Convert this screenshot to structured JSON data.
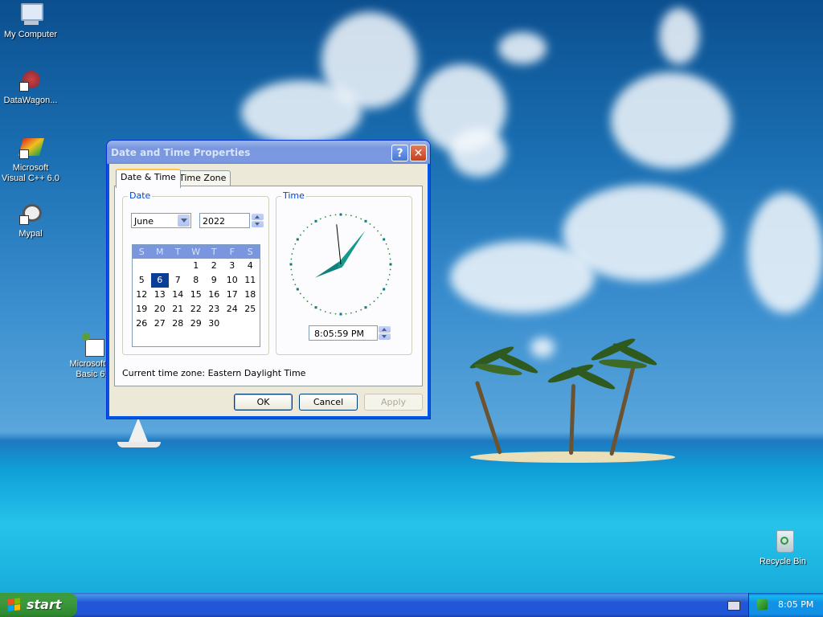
{
  "desktop": {
    "icons": [
      {
        "label": "My Computer"
      },
      {
        "label": "DataWagon..."
      },
      {
        "label": "Microsoft Visual C++ 6.0"
      },
      {
        "label": "Mypal"
      },
      {
        "label": "Microsoft V Basic 6."
      },
      {
        "label": "Recycle Bin"
      }
    ]
  },
  "dialog": {
    "title": "Date and Time Properties",
    "help_glyph": "?",
    "close_glyph": "✕",
    "tabs": [
      {
        "label": "Date & Time",
        "active": true
      },
      {
        "label": "Time Zone",
        "active": false
      }
    ],
    "date_group": {
      "label": "Date",
      "month": "June",
      "year": "2022",
      "weekdays": [
        "S",
        "M",
        "T",
        "W",
        "T",
        "F",
        "S"
      ],
      "weeks": [
        [
          "",
          "",
          "",
          "1",
          "2",
          "3",
          "4"
        ],
        [
          "5",
          "6",
          "7",
          "8",
          "9",
          "10",
          "11"
        ],
        [
          "12",
          "13",
          "14",
          "15",
          "16",
          "17",
          "18"
        ],
        [
          "19",
          "20",
          "21",
          "22",
          "23",
          "24",
          "25"
        ],
        [
          "26",
          "27",
          "28",
          "29",
          "30",
          "",
          ""
        ]
      ],
      "selected_day": "6"
    },
    "time_group": {
      "label": "Time",
      "time_value": "8:05:59 PM"
    },
    "current_time_zone": "Current time zone:  Eastern Daylight Time",
    "buttons": {
      "ok": "OK",
      "cancel": "Cancel",
      "apply": "Apply"
    }
  },
  "taskbar": {
    "start_label": "start",
    "clock": "8:05 PM"
  }
}
